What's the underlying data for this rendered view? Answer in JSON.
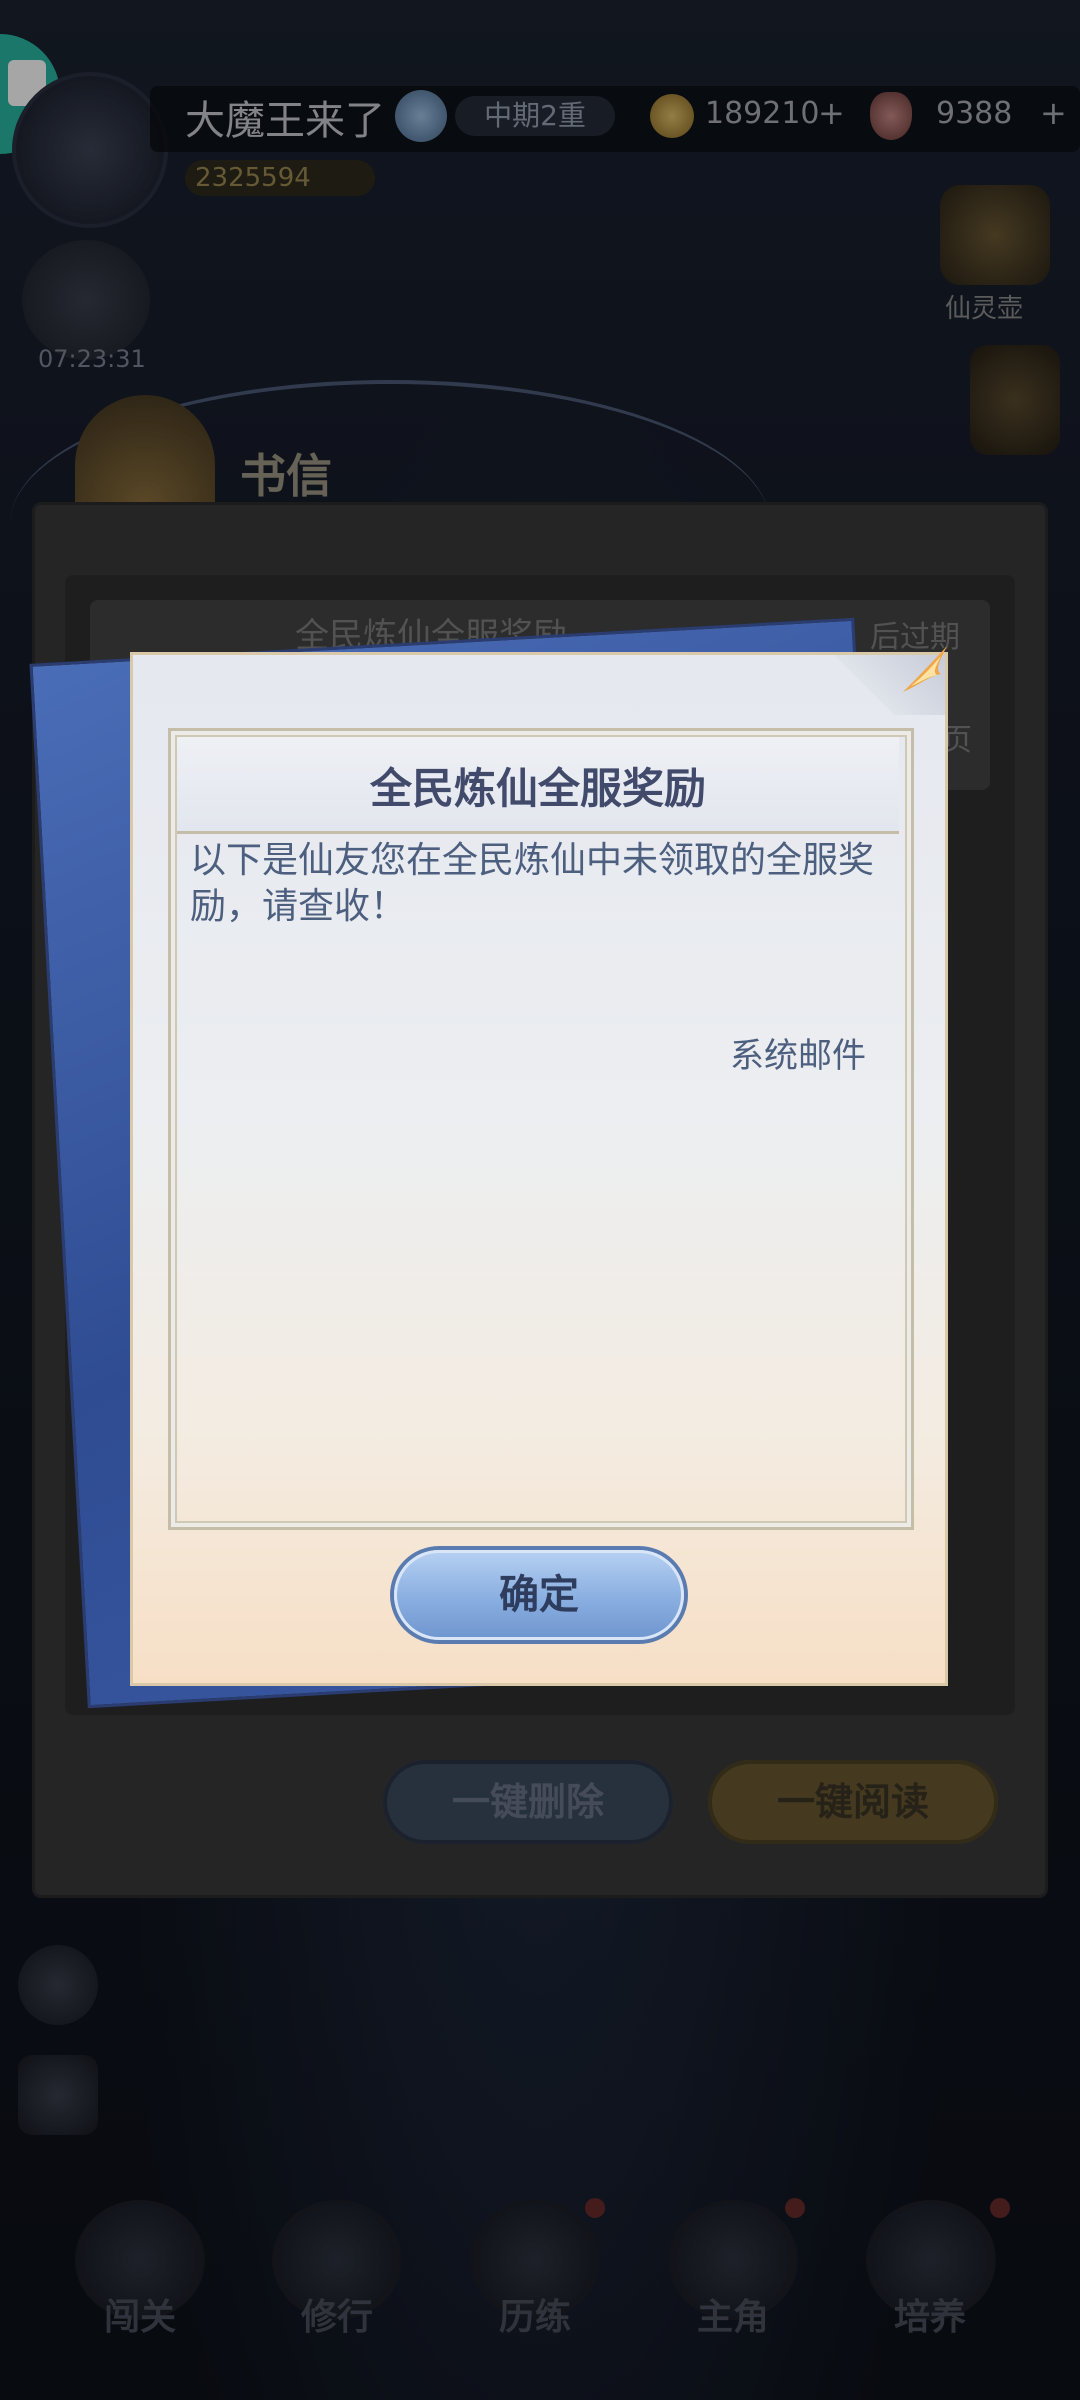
{
  "status_bar": {
    "player_name": "大魔王来了",
    "realm": "中期2重",
    "power": "2325594",
    "coins": "189210",
    "gems": "9388",
    "plus": "+"
  },
  "side": {
    "timer": "07:23:31",
    "gift_label": "仙灵壶"
  },
  "mail_panel": {
    "title": "书信",
    "item_title": "全民炼仙全服奖励",
    "item_status": "后过期",
    "item_status2": "页",
    "delete_all_label": "一键删除",
    "read_all_label": "一键阅读"
  },
  "letter": {
    "title": "全民炼仙全服奖励",
    "body": "以下是仙友您在全民炼仙中未领取的全服奖励，请查收！",
    "signature": "系统邮件",
    "confirm_label": "确定"
  },
  "bottom_nav": {
    "items": [
      {
        "label": "闯关"
      },
      {
        "label": "修行"
      },
      {
        "label": "历练"
      },
      {
        "label": "主角"
      },
      {
        "label": "培养"
      }
    ]
  },
  "colors": {
    "dialog_title": "#414a6a",
    "dialog_text": "#4d5f7f",
    "confirm_button": "#89aee0",
    "read_all_button": "#6b5a32",
    "delete_button": "#3d4a5f"
  }
}
